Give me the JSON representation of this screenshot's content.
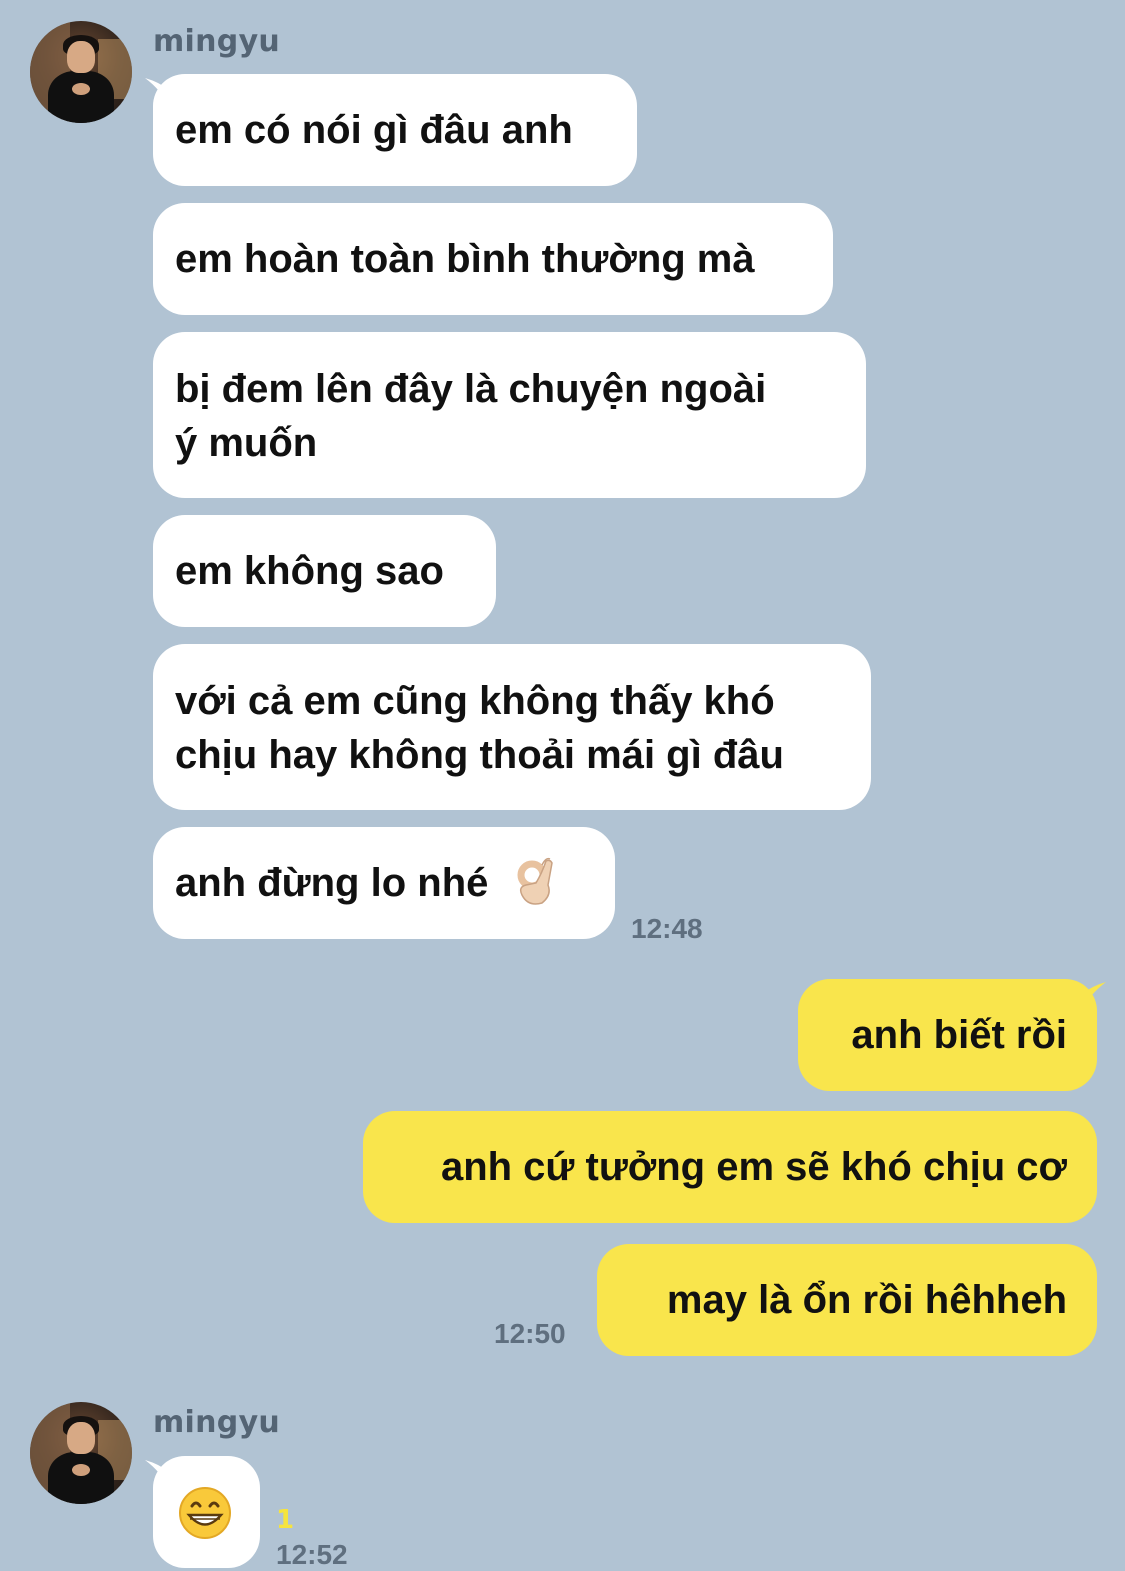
{
  "colors": {
    "background": "#b1c3d3",
    "incoming_bubble": "#ffffff",
    "outgoing_bubble": "#f9e54c",
    "timestamp": "#5f6f7f"
  },
  "group1": {
    "sender": "mingyu",
    "messages": [
      {
        "text": "em có nói gì đâu anh"
      },
      {
        "text": "em hoàn toàn bình thường mà"
      },
      {
        "line1": "bị đem lên đây là chuyện ngoài",
        "line2": "ý muốn"
      },
      {
        "text": "em không sao"
      },
      {
        "line1": "với cả em cũng không thấy khó",
        "line2": "chịu hay không thoải mái gì đâu"
      },
      {
        "text": "anh đừng lo nhé",
        "emoji": "ok-hand-icon"
      }
    ],
    "time": "12:48"
  },
  "outgoing": {
    "messages": [
      {
        "text": "anh biết rồi"
      },
      {
        "text": "anh cứ tưởng em sẽ khó chịu cơ"
      },
      {
        "text": "may là ổn rồi hêhheh"
      }
    ],
    "time": "12:50"
  },
  "group2": {
    "sender": "mingyu",
    "emoji": "grinning-face-icon",
    "unread": "1",
    "time": "12:52"
  }
}
